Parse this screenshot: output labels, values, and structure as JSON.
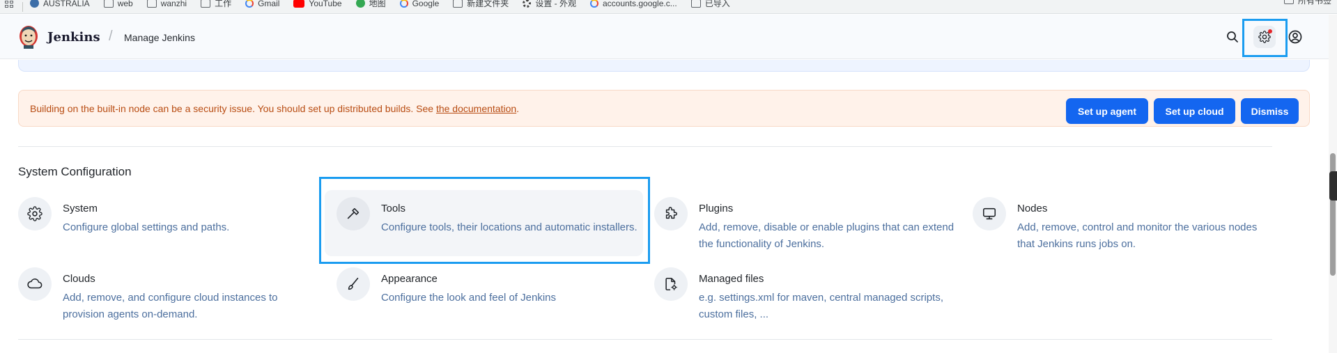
{
  "bookmarks": {
    "items": [
      {
        "label": "AUSTRALIA",
        "icon": "globe-icon"
      },
      {
        "label": "web",
        "icon": "folder-icon"
      },
      {
        "label": "wanzhi",
        "icon": "folder-icon"
      },
      {
        "label": "工作",
        "icon": "folder-icon"
      },
      {
        "label": "Gmail",
        "icon": "google-icon"
      },
      {
        "label": "YouTube",
        "icon": "youtube-icon"
      },
      {
        "label": "地图",
        "icon": "maps-icon"
      },
      {
        "label": "Google",
        "icon": "google-icon"
      },
      {
        "label": "新建文件夹",
        "icon": "folder-icon"
      },
      {
        "label": "设置 - 外观",
        "icon": "gear-icon"
      },
      {
        "label": "accounts.google.c...",
        "icon": "google-icon"
      },
      {
        "label": "已导入",
        "icon": "folder-icon"
      }
    ],
    "all_bookmarks": "所有书签"
  },
  "header": {
    "brand": "Jenkins",
    "separator": "/",
    "breadcrumb": "Manage Jenkins"
  },
  "warning": {
    "text": "Building on the built-in node can be a security issue. You should set up distributed builds. See",
    "link": "the documentation",
    "suffix": ".",
    "buttons": {
      "setup_agent": "Set up agent",
      "setup_cloud": "Set up cloud",
      "dismiss": "Dismiss"
    }
  },
  "section": {
    "title": "System Configuration",
    "items": [
      {
        "title": "System",
        "desc": "Configure global settings and paths.",
        "icon": "gear-icon"
      },
      {
        "title": "Tools",
        "desc": "Configure tools, their locations and automatic installers.",
        "icon": "hammer-icon"
      },
      {
        "title": "Plugins",
        "desc": "Add, remove, disable or enable plugins that can extend the functionality of Jenkins.",
        "icon": "puzzle-icon"
      },
      {
        "title": "Nodes",
        "desc": "Add, remove, control and monitor the various nodes that Jenkins runs jobs on.",
        "icon": "monitor-icon"
      },
      {
        "title": "Clouds",
        "desc": "Add, remove, and configure cloud instances to provision agents on-demand.",
        "icon": "cloud-icon"
      },
      {
        "title": "Appearance",
        "desc": "Configure the look and feel of Jenkins",
        "icon": "brush-icon"
      },
      {
        "title": "Managed files",
        "desc": "e.g. settings.xml for maven, central managed scripts, custom files, ...",
        "icon": "file-gear-icon"
      }
    ]
  },
  "colors": {
    "accent": "#1466f0",
    "highlight": "#1a9cf0",
    "warning_bg": "#fff2ea",
    "warning_text": "#b84c12",
    "notification_dot": "#e5262a"
  }
}
